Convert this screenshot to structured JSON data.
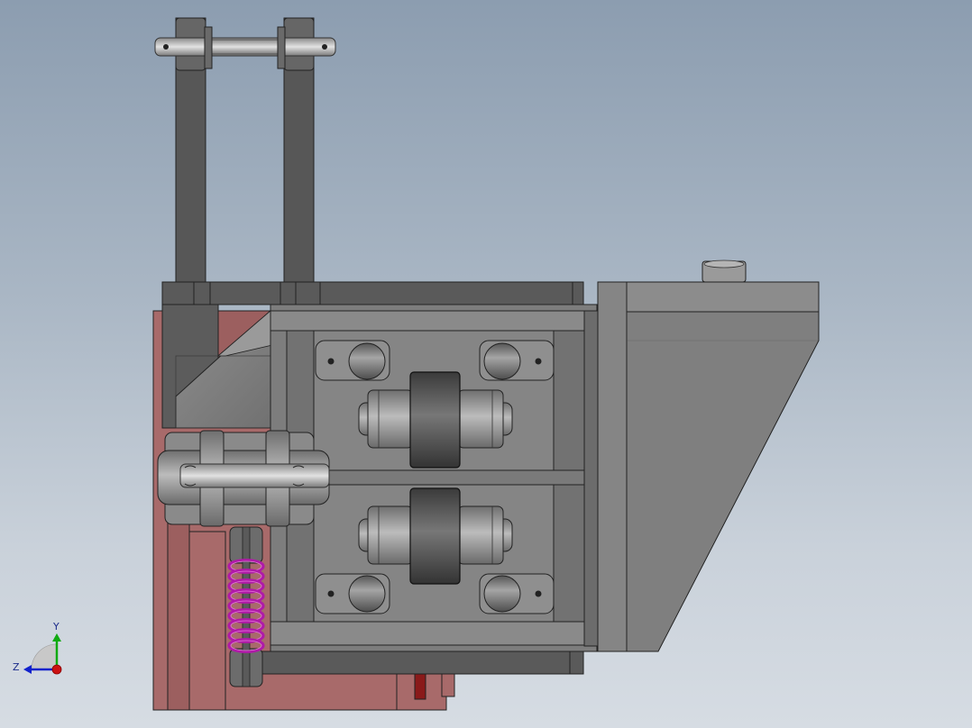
{
  "viewport": {
    "background_top": "#8c9db0",
    "background_bottom": "#d6dce3"
  },
  "colors": {
    "frame_gray": "#5a5a5a",
    "body_gray": "#7d7d7d",
    "light_gray": "#a9a9a9",
    "base_plate": "#a86a6a",
    "spring": "#b01aa8",
    "edge": "#222222"
  },
  "triad": {
    "y_label": "Y",
    "z_label": "Z",
    "x_axis_color": "#cc1111",
    "y_axis_color": "#11aa11",
    "z_axis_color": "#1122cc"
  }
}
